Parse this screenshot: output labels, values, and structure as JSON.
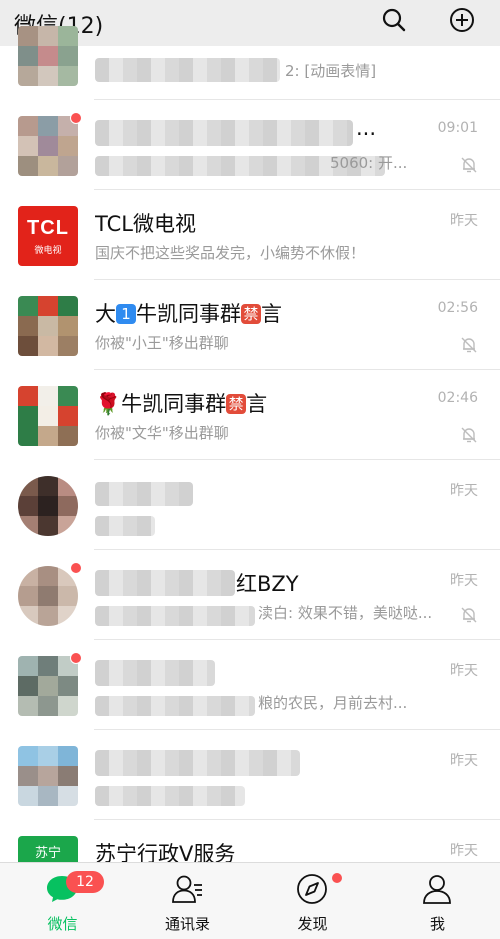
{
  "header": {
    "title": "微信(12)",
    "search_icon": "search-icon",
    "add_icon": "plus-circle-icon"
  },
  "chats": [
    {
      "name": "",
      "preview": "2: [动画表情]",
      "time": "",
      "muted": false
    },
    {
      "name": "...",
      "preview": "5060: 开...",
      "time": "09:01",
      "muted": true
    },
    {
      "name": "TCL微电视",
      "preview": "国庆不把这些奖品发完，小编势不休假！",
      "time": "昨天",
      "muted": false,
      "avatar_text": "TCL",
      "avatar_subtext": "微电视"
    },
    {
      "name_prefix": "大",
      "name_badge1": "1",
      "name_mid": "牛凯同事群",
      "name_badge2": "禁",
      "name_suffix": "言",
      "preview": "你被\"小王\"移出群聊",
      "time": "02:56",
      "muted": true
    },
    {
      "name_prefix": "🌹",
      "name_mid": "牛凯同事群",
      "name_badge2": "禁",
      "name_suffix": "言",
      "preview": "你被\"文华\"移出群聊",
      "time": "02:46",
      "muted": true
    },
    {
      "name": "",
      "preview": "",
      "time": "昨天",
      "muted": false
    },
    {
      "name": "红BZY",
      "preview": "渎白: 效果不错，美哒哒...",
      "time": "昨天",
      "muted": true
    },
    {
      "name": "",
      "preview": "粮的农民，月前去村...",
      "time": "昨天",
      "muted": false
    },
    {
      "name": "",
      "preview": "",
      "time": "昨天",
      "muted": false
    },
    {
      "name": "苏宁行政V服务",
      "preview": "",
      "time": "昨天",
      "muted": false,
      "avatar_text": "苏宁"
    }
  ],
  "tabbar": {
    "tabs": [
      {
        "label": "微信",
        "icon": "chat-bubble-icon",
        "badge": "12"
      },
      {
        "label": "通讯录",
        "icon": "contacts-icon"
      },
      {
        "label": "发现",
        "icon": "compass-icon"
      },
      {
        "label": "我",
        "icon": "person-icon"
      }
    ]
  },
  "colors": {
    "accent": "#07c160",
    "badge": "#fa5151",
    "header_bg": "#ededed",
    "muted_text": "#9a9a9a"
  }
}
